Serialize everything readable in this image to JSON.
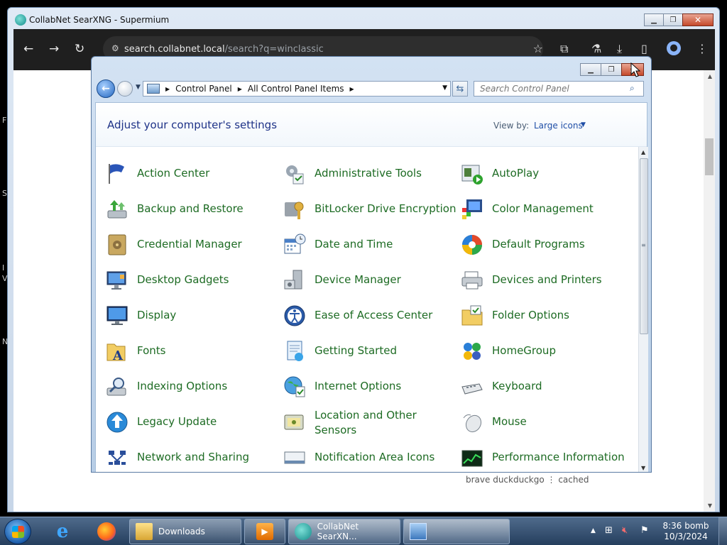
{
  "browser": {
    "window_title": "CollabNet SearXNG - Supermium",
    "url_host": "search.collabnet.local",
    "url_path": "/search?q=winclassic",
    "page_fragment": "brave   duckduckgo   ⋮   cached"
  },
  "desktop_edge": [
    "F",
    "S",
    "I",
    "V",
    "N"
  ],
  "control_panel": {
    "breadcrumb": [
      "Control Panel",
      "All Control Panel Items"
    ],
    "search_placeholder": "Search Control Panel",
    "heading": "Adjust your computer's settings",
    "view_by_label": "View by:",
    "view_by_value": "Large icons",
    "items": [
      {
        "label": "Action Center",
        "icon": "flag-icon"
      },
      {
        "label": "Administrative Tools",
        "icon": "tools-icon"
      },
      {
        "label": "AutoPlay",
        "icon": "autoplay-icon"
      },
      {
        "label": "Backup and Restore",
        "icon": "backup-icon"
      },
      {
        "label": "BitLocker Drive Encryption",
        "icon": "key-icon"
      },
      {
        "label": "Color Management",
        "icon": "color-icon"
      },
      {
        "label": "Credential Manager",
        "icon": "vault-icon"
      },
      {
        "label": "Date and Time",
        "icon": "calendar-clock-icon"
      },
      {
        "label": "Default Programs",
        "icon": "default-programs-icon"
      },
      {
        "label": "Desktop Gadgets",
        "icon": "gadgets-icon"
      },
      {
        "label": "Device Manager",
        "icon": "device-manager-icon"
      },
      {
        "label": "Devices and Printers",
        "icon": "printer-icon"
      },
      {
        "label": "Display",
        "icon": "monitor-icon"
      },
      {
        "label": "Ease of Access Center",
        "icon": "accessibility-icon"
      },
      {
        "label": "Folder Options",
        "icon": "folder-icon"
      },
      {
        "label": "Fonts",
        "icon": "fonts-icon"
      },
      {
        "label": "Getting Started",
        "icon": "getting-started-icon"
      },
      {
        "label": "HomeGroup",
        "icon": "homegroup-icon"
      },
      {
        "label": "Indexing Options",
        "icon": "indexing-icon"
      },
      {
        "label": "Internet Options",
        "icon": "globe-icon"
      },
      {
        "label": "Keyboard",
        "icon": "keyboard-icon"
      },
      {
        "label": "Legacy Update",
        "icon": "update-icon"
      },
      {
        "label": "Location and Other Sensors",
        "icon": "sensors-icon"
      },
      {
        "label": "Mouse",
        "icon": "mouse-icon"
      },
      {
        "label": "Network and Sharing",
        "icon": "network-icon"
      },
      {
        "label": "Notification Area Icons",
        "icon": "notification-icon"
      },
      {
        "label": "Performance Information",
        "icon": "performance-icon"
      }
    ]
  },
  "taskbar": {
    "tasks": [
      {
        "label": "Downloads",
        "icon": "folder-icon"
      },
      {
        "label": "",
        "icon": "media-player-icon"
      },
      {
        "label": "CollabNet SearXN...",
        "icon": "supermium-icon"
      },
      {
        "label": "",
        "icon": "control-panel-icon"
      }
    ],
    "clock_time": "8:36 bomb",
    "clock_date": "10/3/2024"
  },
  "colors": {
    "item_link": "#1d6b23",
    "heading": "#1e3287",
    "taskbar_top": "#4f6b8c",
    "close_button": "#c54a2b"
  }
}
